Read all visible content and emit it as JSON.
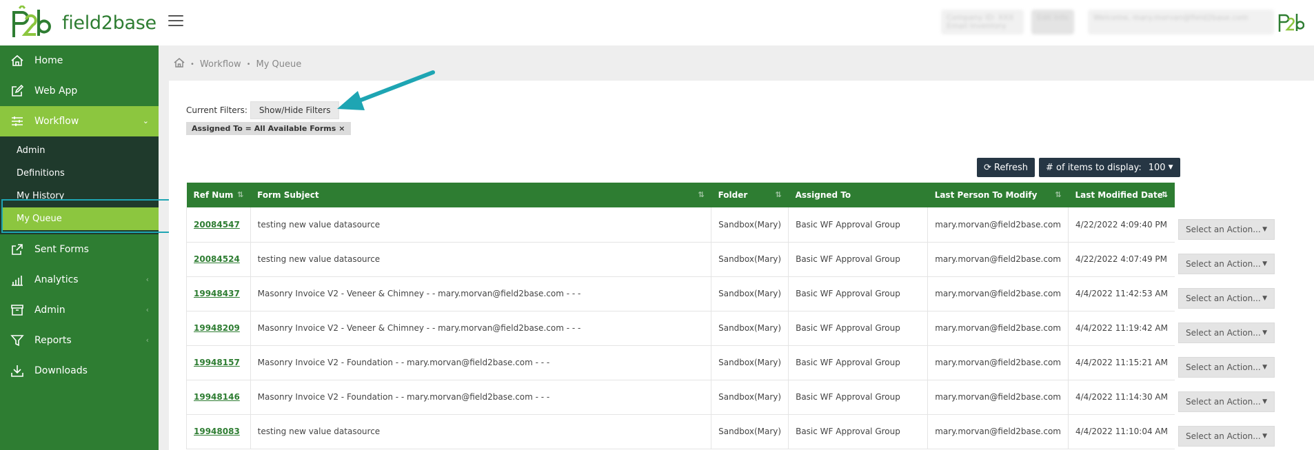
{
  "header": {
    "brand": "field2base",
    "blurred_left": "Company ID: XXX Email Inventory",
    "blurred_mid": "Edit Info",
    "blurred_right": "Welcome, mary.morvan@field2base.com"
  },
  "sidebar": {
    "items": [
      {
        "label": "Home",
        "icon": "home-icon"
      },
      {
        "label": "Web App",
        "icon": "edit-icon"
      },
      {
        "label": "Workflow",
        "icon": "workflow-icon",
        "active": true
      },
      {
        "label": "Sent Forms",
        "icon": "share-icon"
      },
      {
        "label": "Analytics",
        "icon": "bar-chart-icon"
      },
      {
        "label": "Admin",
        "icon": "archive-icon"
      },
      {
        "label": "Reports",
        "icon": "filter-icon"
      },
      {
        "label": "Downloads",
        "icon": "download-icon"
      }
    ],
    "workflow_sub": [
      "Admin",
      "Definitions",
      "My History",
      "My Queue"
    ]
  },
  "breadcrumb": {
    "items": [
      "Workflow",
      "My Queue"
    ]
  },
  "filters": {
    "label": "Current Filters:",
    "toggle": "Show/Hide Filters",
    "tag": "Assigned To = All Available Forms",
    "tag_remove": "×"
  },
  "toolbar": {
    "refresh": "Refresh",
    "items_label": "# of items to display:",
    "items_value": "100"
  },
  "table": {
    "columns": [
      "Ref Num",
      "Form Subject",
      "Folder",
      "Assigned To",
      "Last Person To Modify",
      "Last Modified Date"
    ],
    "action_label": "Select an Action...",
    "rows": [
      [
        "20084547",
        "testing new value datasource",
        "Sandbox(Mary)",
        "Basic WF Approval Group",
        "mary.morvan@field2base.com",
        "4/22/2022 4:09:40 PM"
      ],
      [
        "20084524",
        "testing new value datasource",
        "Sandbox(Mary)",
        "Basic WF Approval Group",
        "mary.morvan@field2base.com",
        "4/22/2022 4:07:49 PM"
      ],
      [
        "19948437",
        "Masonry Invoice V2 - Veneer & Chimney - - mary.morvan@field2base.com - - -",
        "Sandbox(Mary)",
        "Basic WF Approval Group",
        "mary.morvan@field2base.com",
        "4/4/2022 11:42:53 AM"
      ],
      [
        "19948209",
        "Masonry Invoice V2 - Veneer & Chimney - - mary.morvan@field2base.com - - -",
        "Sandbox(Mary)",
        "Basic WF Approval Group",
        "mary.morvan@field2base.com",
        "4/4/2022 11:19:42 AM"
      ],
      [
        "19948157",
        "Masonry Invoice V2 - Foundation - - mary.morvan@field2base.com - - -",
        "Sandbox(Mary)",
        "Basic WF Approval Group",
        "mary.morvan@field2base.com",
        "4/4/2022 11:15:21 AM"
      ],
      [
        "19948146",
        "Masonry Invoice V2 - Foundation - - mary.morvan@field2base.com - - -",
        "Sandbox(Mary)",
        "Basic WF Approval Group",
        "mary.morvan@field2base.com",
        "4/4/2022 11:14:30 AM"
      ],
      [
        "19948083",
        "testing new value datasource",
        "Sandbox(Mary)",
        "Basic WF Approval Group",
        "mary.morvan@field2base.com",
        "4/4/2022 11:10:04 AM"
      ]
    ]
  },
  "colors": {
    "brand_green": "#2e7d32",
    "active_green": "#8cc63f",
    "submenu_bg": "#1f3a2c",
    "annotation_teal": "#1ea5b3",
    "button_dark": "#263644"
  }
}
